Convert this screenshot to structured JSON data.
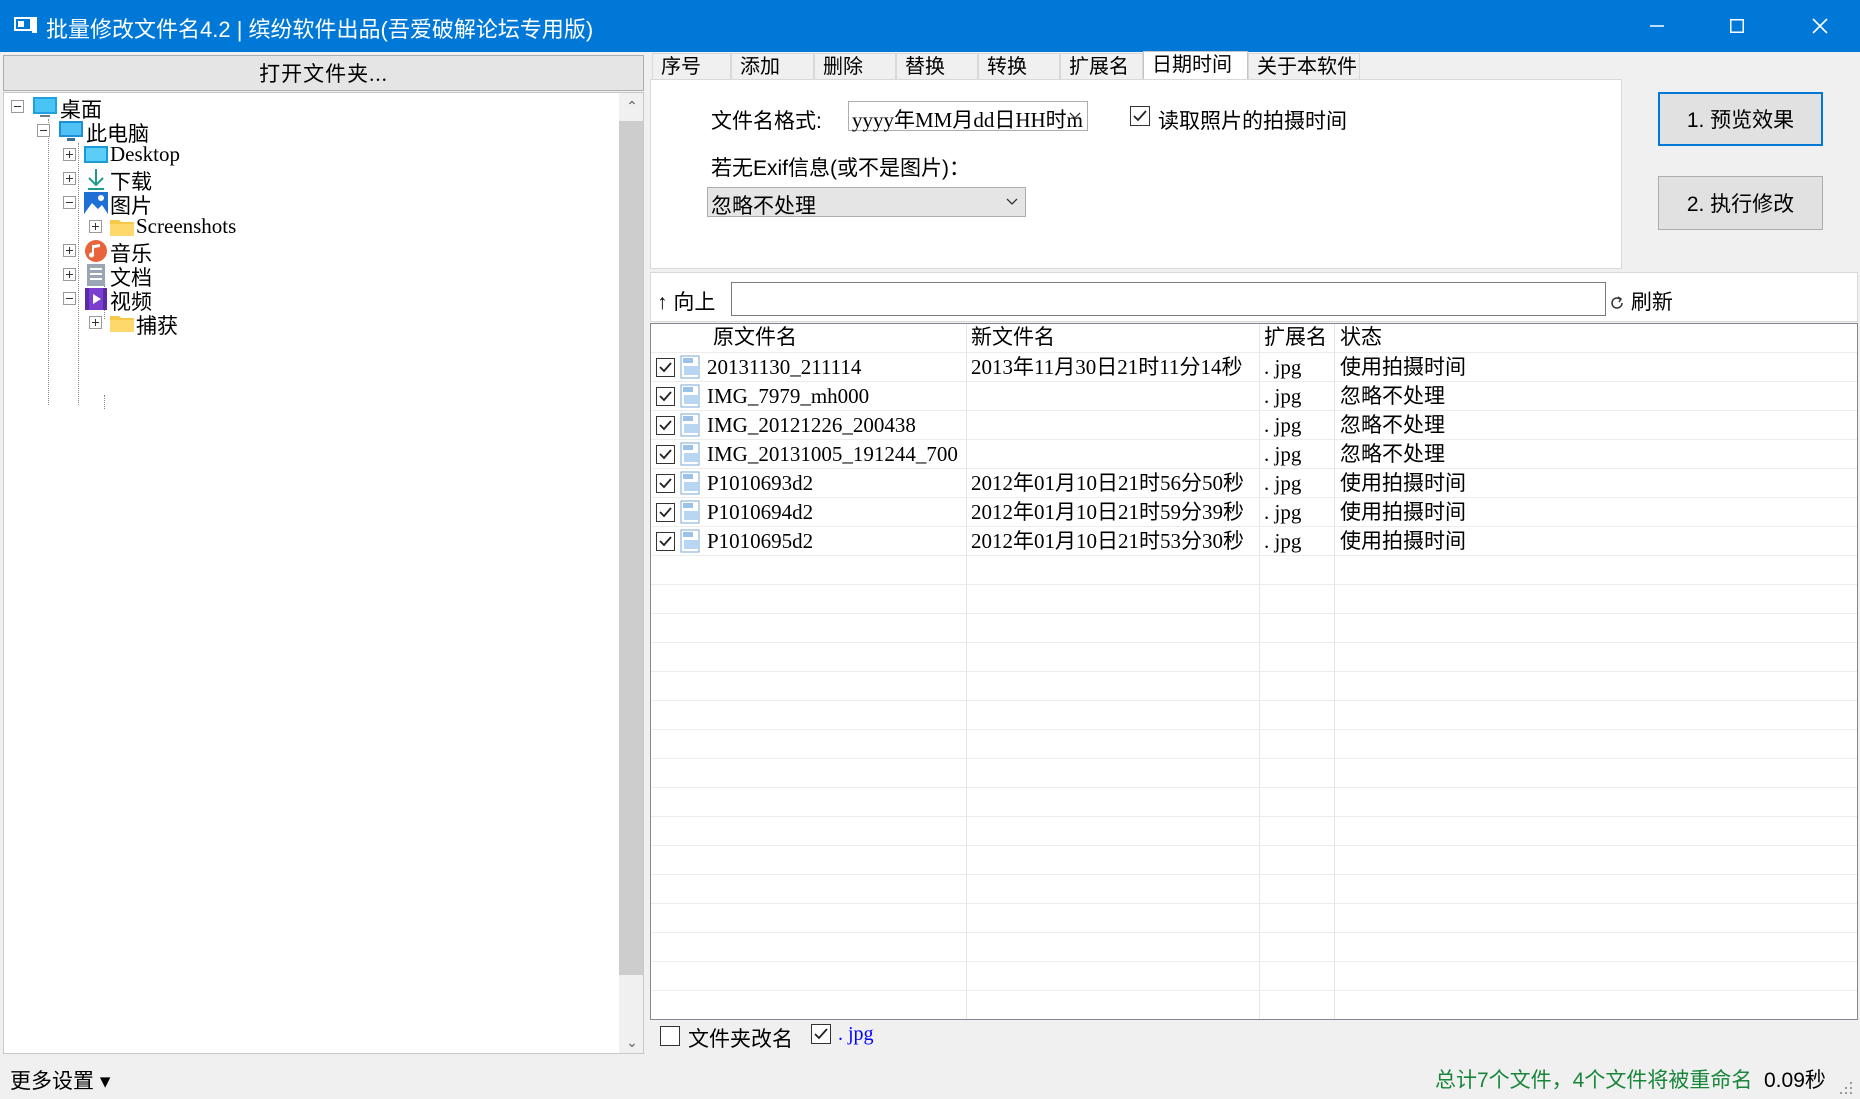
{
  "window": {
    "title": "批量修改文件名4.2 | 缤纷软件出品(吾爱破解论坛专用版)",
    "minimize_icon": "minimize-icon",
    "maximize_icon": "maximize-icon",
    "close_icon": "close-icon"
  },
  "left_panel": {
    "open_folder_label": "打开文件夹...",
    "tree": [
      {
        "label": "桌面",
        "icon": "desktop-icon",
        "expanded": true
      },
      {
        "label": "此电脑",
        "icon": "computer-icon",
        "expanded": true
      },
      {
        "label": "Desktop",
        "icon": "desktop-folder-icon",
        "expanded": false
      },
      {
        "label": "下载",
        "icon": "download-icon",
        "expanded": false
      },
      {
        "label": "图片",
        "icon": "pictures-icon",
        "expanded": true
      },
      {
        "label": "Screenshots",
        "icon": "folder-icon",
        "expanded": false
      },
      {
        "label": "音乐",
        "icon": "music-icon",
        "expanded": false
      },
      {
        "label": "文档",
        "icon": "documents-icon",
        "expanded": false
      },
      {
        "label": "视频",
        "icon": "videos-icon",
        "expanded": true
      },
      {
        "label": "捕获",
        "icon": "folder-icon",
        "expanded": false
      }
    ]
  },
  "tabs": [
    {
      "label": "序号",
      "active": false
    },
    {
      "label": "添加",
      "active": false
    },
    {
      "label": "删除",
      "active": false
    },
    {
      "label": "替换",
      "active": false
    },
    {
      "label": "转换",
      "active": false
    },
    {
      "label": "扩展名",
      "active": false
    },
    {
      "label": "日期时间",
      "active": true
    },
    {
      "label": "关于本软件",
      "active": false
    }
  ],
  "datetime_tab": {
    "format_label": "文件名格式:",
    "format_value": "yyyy年MM月dd日HH时m",
    "read_photo_time_label": "读取照片的拍摄时间",
    "read_photo_time_checked": true,
    "no_exif_label": "若无Exif信息(或不是图片)：",
    "no_exif_value": "忽略不处理"
  },
  "buttons": {
    "preview": "1. 预览效果",
    "execute": "2. 执行修改"
  },
  "path_bar": {
    "up_label": "↑ 向上",
    "path_value": "",
    "refresh_label": "刷新"
  },
  "file_list": {
    "columns": [
      "原文件名",
      "新文件名",
      "扩展名",
      "状态"
    ],
    "rows": [
      {
        "checked": true,
        "original": "20131130_211114",
        "new": "2013年11月30日21时11分14秒",
        "ext": ". jpg",
        "status": "使用拍摄时间"
      },
      {
        "checked": true,
        "original": "IMG_7979_mh000",
        "new": "",
        "ext": ". jpg",
        "status": "忽略不处理"
      },
      {
        "checked": true,
        "original": "IMG_20121226_200438",
        "new": "",
        "ext": ". jpg",
        "status": "忽略不处理"
      },
      {
        "checked": true,
        "original": "IMG_20131005_191244_700",
        "new": "",
        "ext": ". jpg",
        "status": "忽略不处理"
      },
      {
        "checked": true,
        "original": "P1010693d2",
        "new": "2012年01月10日21时56分50秒",
        "ext": ". jpg",
        "status": "使用拍摄时间"
      },
      {
        "checked": true,
        "original": "P1010694d2",
        "new": "2012年01月10日21时59分39秒",
        "ext": ". jpg",
        "status": "使用拍摄时间"
      },
      {
        "checked": true,
        "original": "P1010695d2",
        "new": "2012年01月10日21时53分30秒",
        "ext": ". jpg",
        "status": "使用拍摄时间"
      }
    ]
  },
  "options": {
    "folder_rename_label": "文件夹改名",
    "folder_rename_checked": false,
    "ext_filter_label": ". jpg",
    "ext_filter_checked": true
  },
  "status_bar": {
    "more_settings": "更多设置 ▾",
    "summary": "总计7个文件，4个文件将被重命名",
    "time": "0.09秒"
  },
  "colors": {
    "titlebar": "#0078d7",
    "status_green": "#17863a",
    "ext_blue": "#0000ff"
  }
}
